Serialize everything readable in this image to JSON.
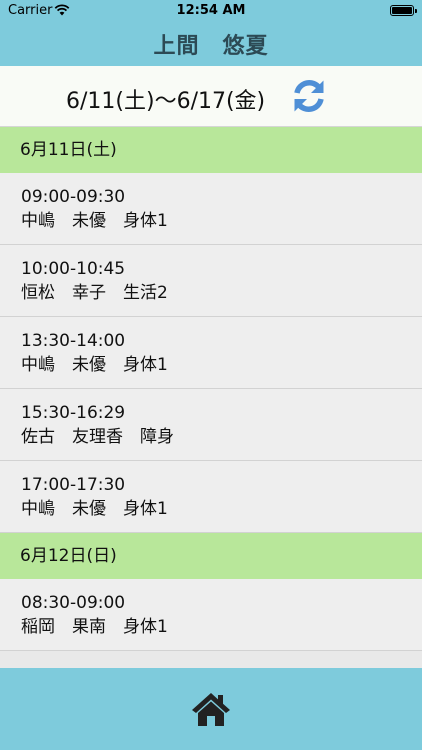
{
  "status": {
    "carrier": "Carrier",
    "time": "12:54 AM"
  },
  "header": {
    "title": "上間　悠夏"
  },
  "range": {
    "text": "6/11(土)～6/17(金)",
    "refresh_icon": "refresh-icon"
  },
  "days": [
    {
      "label": "6月11日(土)",
      "items": [
        {
          "time": "09:00-09:30",
          "name": "中嶋　未優",
          "service": "身体1"
        },
        {
          "time": "10:00-10:45",
          "name": "恒松　幸子",
          "service": "生活2"
        },
        {
          "time": "13:30-14:00",
          "name": "中嶋　未優",
          "service": "身体1"
        },
        {
          "time": "15:30-16:29",
          "name": "佐古　友理香",
          "service": "障身"
        },
        {
          "time": "17:00-17:30",
          "name": "中嶋　未優",
          "service": "身体1"
        }
      ]
    },
    {
      "label": "6月12日(日)",
      "items": [
        {
          "time": "08:30-09:00",
          "name": "稲岡　果南",
          "service": "身体1"
        }
      ]
    }
  ],
  "footer": {
    "home_icon": "home-icon"
  },
  "colors": {
    "bar": "#7ecbdc",
    "day_header": "#b8e79a",
    "icon": "#4f8fd6"
  }
}
